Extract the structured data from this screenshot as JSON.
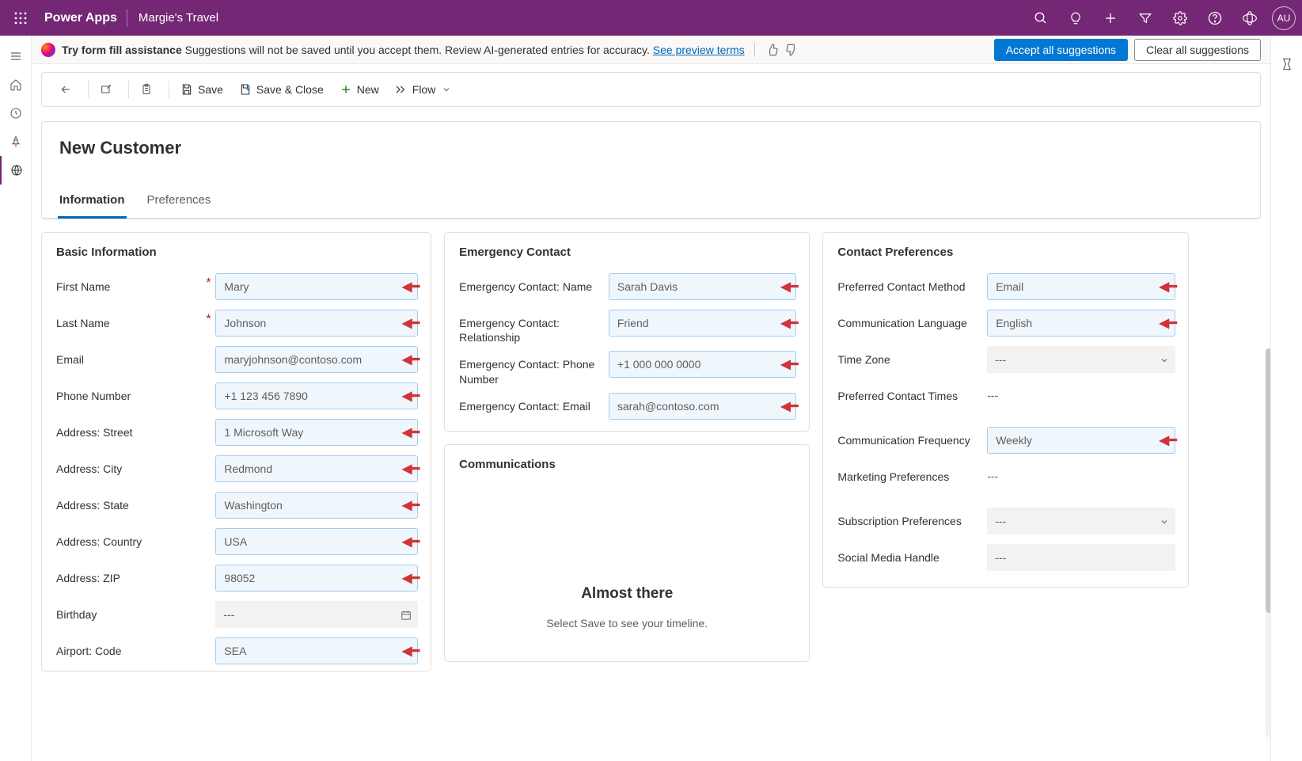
{
  "topbar": {
    "brand": "Power Apps",
    "app_name": "Margie's Travel",
    "avatar_initials": "AU"
  },
  "suggestbar": {
    "bold": "Try form fill assistance",
    "text": " Suggestions will not be saved until you accept them. Review AI-generated entries for accuracy. ",
    "link": "See preview terms",
    "accept": "Accept all suggestions",
    "clear": "Clear all suggestions"
  },
  "commandbar": {
    "save": "Save",
    "save_close": "Save & Close",
    "new": "New",
    "flow": "Flow"
  },
  "page": {
    "title": "New Customer",
    "tabs": [
      "Information",
      "Preferences"
    ]
  },
  "sections": {
    "basic": {
      "title": "Basic Information",
      "fields": {
        "first_name": {
          "label": "First Name",
          "value": "Mary"
        },
        "last_name": {
          "label": "Last Name",
          "value": "Johnson"
        },
        "email": {
          "label": "Email",
          "value": "maryjohnson@contoso.com"
        },
        "phone": {
          "label": "Phone Number",
          "value": "+1 123 456 7890"
        },
        "street": {
          "label": "Address: Street",
          "value": "1 Microsoft Way"
        },
        "city": {
          "label": "Address: City",
          "value": "Redmond"
        },
        "state": {
          "label": "Address: State",
          "value": "Washington"
        },
        "country": {
          "label": "Address: Country",
          "value": "USA"
        },
        "zip": {
          "label": "Address: ZIP",
          "value": "98052"
        },
        "birthday": {
          "label": "Birthday",
          "value": "---"
        },
        "airport": {
          "label": "Airport: Code",
          "value": "SEA"
        }
      }
    },
    "emergency": {
      "title": "Emergency Contact",
      "fields": {
        "name": {
          "label": "Emergency Contact: Name",
          "value": "Sarah Davis"
        },
        "relationship": {
          "label": "Emergency Contact: Relationship",
          "value": "Friend"
        },
        "phone": {
          "label": "Emergency Contact: Phone Number",
          "value": "+1 000 000 0000"
        },
        "email": {
          "label": "Emergency Contact: Email",
          "value": "sarah@contoso.com"
        }
      }
    },
    "communications": {
      "title": "Communications",
      "empty_title": "Almost there",
      "empty_text": "Select Save to see your timeline."
    },
    "preferences": {
      "title": "Contact Preferences",
      "fields": {
        "method": {
          "label": "Preferred Contact Method",
          "value": "Email"
        },
        "language": {
          "label": "Communication Language",
          "value": "English"
        },
        "timezone": {
          "label": "Time Zone",
          "value": "---"
        },
        "times": {
          "label": "Preferred Contact Times",
          "value": "---"
        },
        "frequency": {
          "label": "Communication Frequency",
          "value": "Weekly"
        },
        "marketing": {
          "label": "Marketing Preferences",
          "value": "---"
        },
        "subscription": {
          "label": "Subscription Preferences",
          "value": "---"
        },
        "social": {
          "label": "Social Media Handle",
          "value": "---"
        }
      }
    }
  }
}
